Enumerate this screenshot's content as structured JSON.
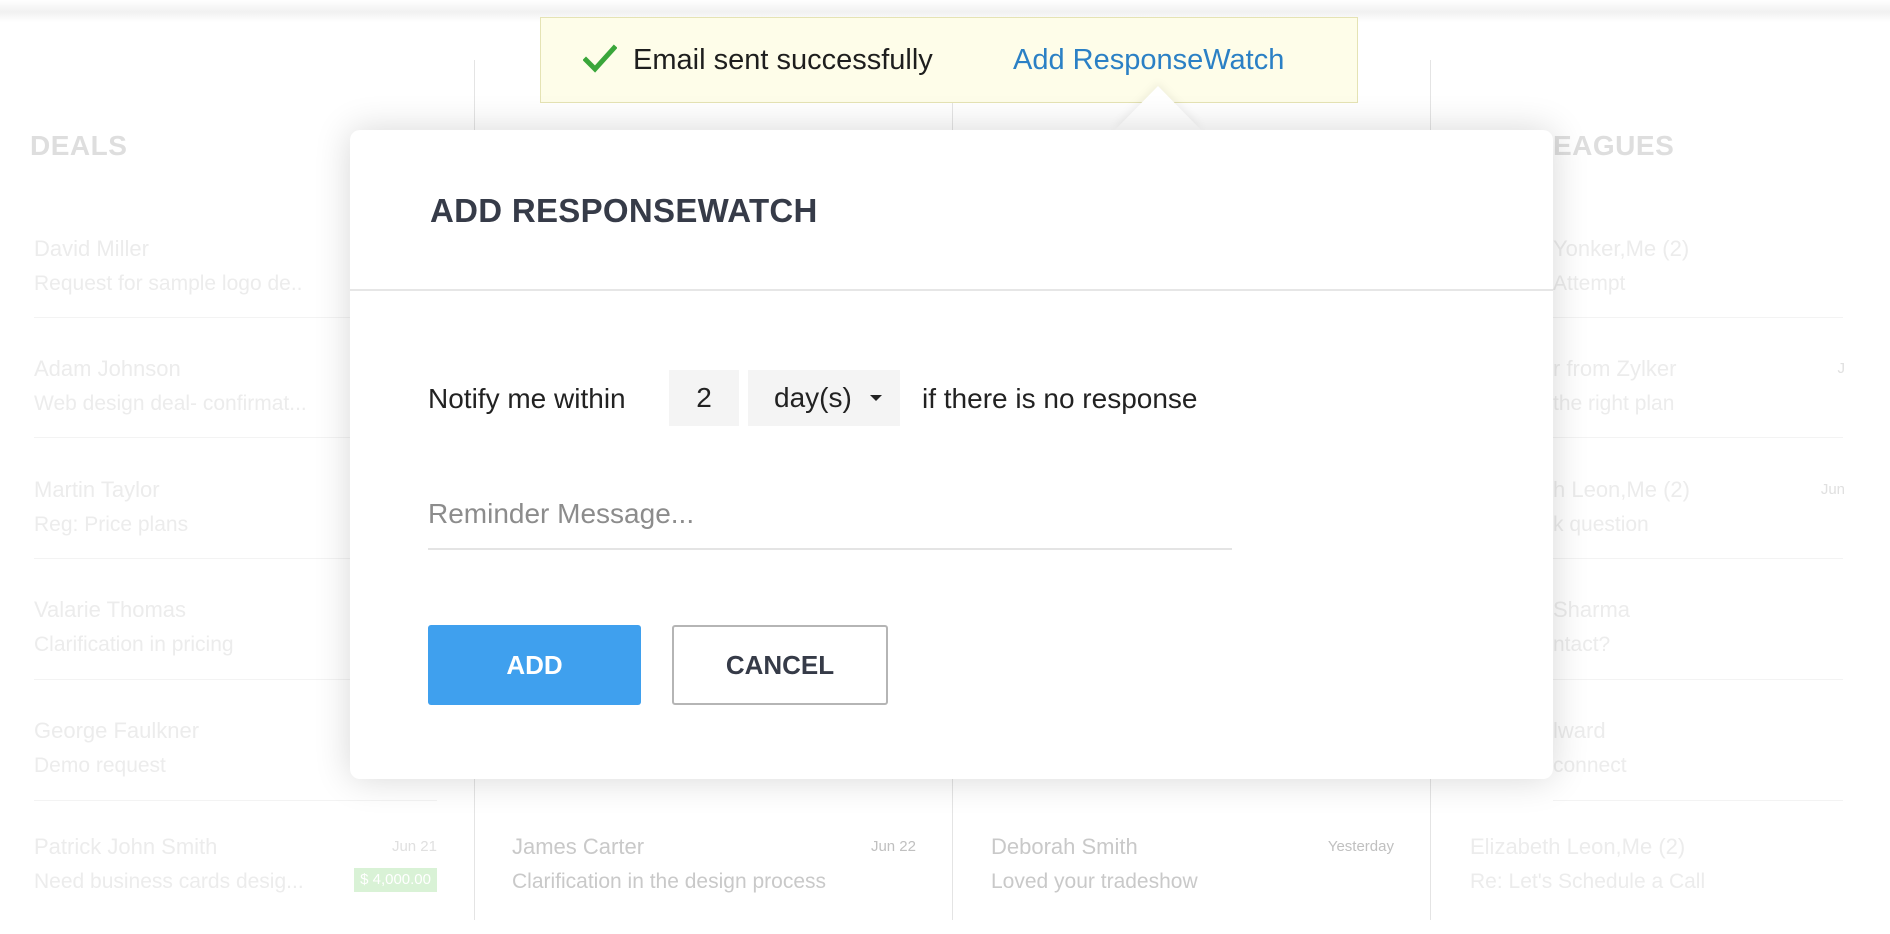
{
  "background": {
    "columns": [
      {
        "header": "DEALS",
        "rows": [
          {
            "name": "David Miller",
            "subject": "Request for sample logo de..",
            "date": "",
            "badge": "$"
          },
          {
            "name": "Adam Johnson",
            "subject": "Web design deal- confirmat...",
            "date": "",
            "badge": "$"
          },
          {
            "name": "Martin Taylor",
            "subject": "Reg: Price plans",
            "date": "",
            "badge": "$"
          },
          {
            "name": "Valarie Thomas",
            "subject": "Clarification in pricing",
            "date": "",
            "badge": "$"
          },
          {
            "name": "George Faulkner",
            "subject": "Demo request",
            "date": "",
            "badge": "$"
          },
          {
            "name": "Patrick John Smith",
            "subject": "Need business cards desig...",
            "date": "Jun 21",
            "badge": "$ 4,000.00"
          }
        ]
      },
      {
        "header": "",
        "rows": [
          {
            "name": "James Carter",
            "subject": "Clarification in the design process",
            "date": "Jun 22"
          }
        ]
      },
      {
        "header": "",
        "rows": [
          {
            "name": "Deborah Smith",
            "subject": "Loved your tradeshow",
            "date": "Yesterday"
          }
        ]
      },
      {
        "header": "EAGUES",
        "rows": [
          {
            "name": "Yonker,Me (2)",
            "subject": "Attempt",
            "date": ""
          },
          {
            "name": "r from Zylker",
            "subject": "the right plan",
            "date": "J"
          },
          {
            "name": "h Leon,Me (2)",
            "subject": "k question",
            "date": "Jun"
          },
          {
            "name": "Sharma",
            "subject": "ntact?",
            "date": ""
          },
          {
            "name": "lward",
            "subject": "connect",
            "date": ""
          },
          {
            "name": "Elizabeth Leon,Me (2)",
            "subject": "Re: Let's Schedule a Call",
            "date": ""
          }
        ]
      }
    ]
  },
  "banner": {
    "icon": "check-icon",
    "message": "Email sent successfully",
    "link": "Add ResponseWatch",
    "check_color": "#3aa63a",
    "link_color": "#2b80c5"
  },
  "modal": {
    "title": "ADD RESPONSEWATCH",
    "notify_prefix": "Notify me within",
    "amount": "2",
    "unit": "day(s)",
    "notify_suffix": "if there is no response",
    "reminder_placeholder": "Reminder Message...",
    "reminder_value": "",
    "add_label": "ADD",
    "cancel_label": "CANCEL",
    "accent_color": "#3fa0ee"
  }
}
